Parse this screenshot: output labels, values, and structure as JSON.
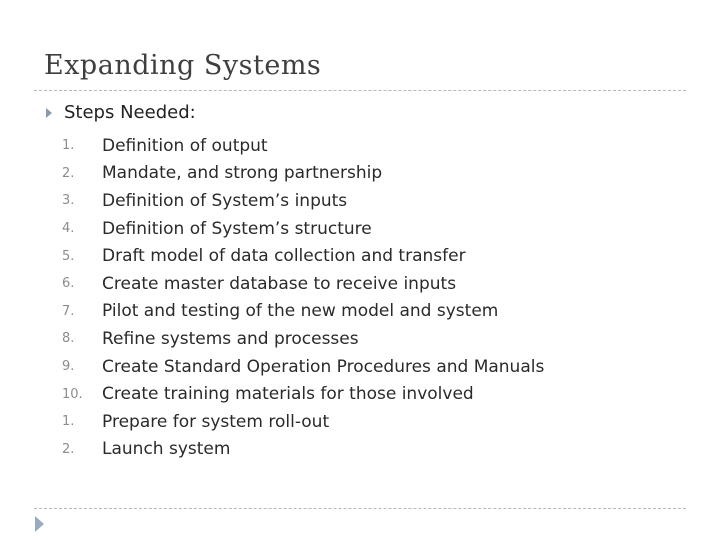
{
  "slide": {
    "title": "Expanding Systems",
    "main_bullet": "Steps Needed:",
    "steps": [
      {
        "num": "1.",
        "text": "Definition of output"
      },
      {
        "num": "2.",
        "text": "Mandate, and strong partnership"
      },
      {
        "num": "3.",
        "text": "Definition of System’s inputs"
      },
      {
        "num": "4.",
        "text": "Definition of System’s structure"
      },
      {
        "num": "5.",
        "text": "Draft model of data collection and transfer"
      },
      {
        "num": "6.",
        "text": "Create master database to receive inputs"
      },
      {
        "num": "7.",
        "text": "Pilot and testing of the new model and system"
      },
      {
        "num": "8.",
        "text": "Refine systems and processes"
      },
      {
        "num": "9.",
        "text": "Create Standard Operation Procedures and Manuals"
      },
      {
        "num": "10.",
        "text": "Create training materials for those involved"
      },
      {
        "num": "1.",
        "text": "Prepare for system roll-out"
      },
      {
        "num": "2.",
        "text": "Launch system"
      }
    ]
  },
  "icons": {
    "bullet": "triangle-right-icon",
    "footer": "triangle-right-icon"
  }
}
